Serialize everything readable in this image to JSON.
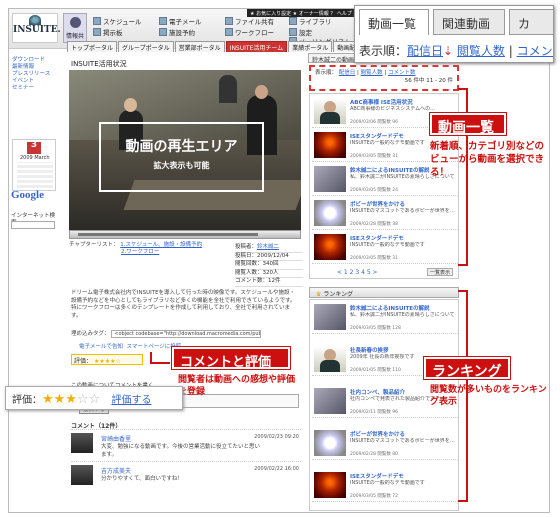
{
  "header": {
    "logo": "INSUITE.",
    "info_button": "情報共有",
    "menu": [
      {
        "label": "スケジュール"
      },
      {
        "label": "電子メール"
      },
      {
        "label": "ファイル共有"
      },
      {
        "label": "ライブラリ"
      },
      {
        "label": "掲示板"
      },
      {
        "label": "施設予約"
      },
      {
        "label": "設定"
      },
      {
        "label": "ワークフロー"
      },
      {
        "label": "メーリングリスト"
      }
    ],
    "topright": "★ お気に入り設定 ★ オーナー情報 ？ ヘルプ ログアウト"
  },
  "nav_tabs": [
    "トップポータル",
    "グループポータル",
    "営業部ポータル",
    "INSUITE活用チーム",
    "業績ポータル",
    "動画配信"
  ],
  "sidebar": {
    "links": [
      "ダウンロード",
      "最新情報",
      "プレスリリース",
      "イベント",
      "セミナー"
    ],
    "calendar_day": "3",
    "calendar_month": "2009 March",
    "search_label": "インターネット検索",
    "google": "Google"
  },
  "video": {
    "page_title": "INSUITE活用状況",
    "play_area_title": "動画の再生エリア",
    "play_area_sub": "拡大表示も可能",
    "chapter_label": "チャプターリスト：",
    "chapter_links": [
      "1.スケジュール、施設・設備予約",
      "2.ワークフロー"
    ],
    "meta": [
      {
        "k": "投稿者：",
        "v": "鈴木誠二"
      },
      {
        "k": "投稿日：",
        "v": "2009/12/04"
      },
      {
        "k": "閲覧回数：",
        "v": "340回"
      },
      {
        "k": "閲覧人数：",
        "v": "320人"
      },
      {
        "k": "コメント数：",
        "v": "12件"
      }
    ],
    "description": "ドリーム電子株式会社内でINSUITEを導入して行った時の映像です。スケジュールや施設・設備予約などを中心としてもライブラリなど多くの機能を全社で利用できているようです。特にワークフローは多くのテンプレートを作成して利用しており、全社で利用されています。",
    "embed_label": "埋め込みタグ：",
    "embed_value": "<object codebase=\"http://download.macromedia.com/pub/shockwave",
    "send_mail": "電子メールで告知",
    "smartphone": "スマートページに投稿",
    "rating_label": "評価：",
    "rating": 4,
    "comment_prompt": "この動画についてコメントを書く",
    "post_button": "投稿する",
    "comments_heading": "コメント（12件）",
    "comments": [
      {
        "name": "宮崎由香里",
        "text": "大変、勉強になる動画です。今後の営業活動に役立てたいと思います。",
        "date": "2009/02/23 09:20"
      },
      {
        "name": "吉方成美夫",
        "text": "分かりやすくて、面白いですね！",
        "date": "2009/02/22 16:00"
      }
    ]
  },
  "list": {
    "header": "鈴木誠二の動画一覧",
    "sort_label": "表示順：",
    "sort_options": [
      "配信日",
      "閲覧人数",
      "コメント数"
    ],
    "page_info": "56 件中 11 - 20 件",
    "items": [
      {
        "title": "ABC商事様 ISE活用状況",
        "desc": "ABC商事様のビジネスシステムへの…",
        "stats": "2009/03/06 閲覧数 96"
      },
      {
        "title": "ISEスタンダードデモ",
        "desc": "INSUITEの一般的なデモ動画です",
        "stats": "2009/03/05 閲覧数 31"
      },
      {
        "title": "鈴木誠二によるINSUITEの解説",
        "desc": "私、鈴木誠二がINSUITEの素晴らしさについて…",
        "stats": "2009/03/05 閲覧数 24"
      },
      {
        "title": "ポビーが世界をかける",
        "desc": "INSUITEのマスコットであるポビーが世界を…",
        "stats": "2009/02/28 閲覧数 38"
      }
    ],
    "pager": "< 1 2 3 4 5 >",
    "all_button": "一覧表示"
  },
  "ranking": {
    "header": "ランキング",
    "items": [
      {
        "title": "鈴木誠二によるINSUITEの解説",
        "desc": "私、鈴木誠二がINSUITEの素晴らしさについて…",
        "stats": "2009/03/05 閲覧数 128"
      },
      {
        "title": "社長新春の挨拶",
        "desc": "2009年 社長の新年挨拶です",
        "stats": "2009/01/05 閲覧数 110"
      },
      {
        "title": "社内コンペ、製品紹介",
        "desc": "社内コンペで発表された製品紹介です",
        "stats": "2009/02/11 閲覧数 96"
      },
      {
        "title": "ポビーが世界をかける",
        "desc": "INSUITEのマスコットであるポビーが世界を…",
        "stats": "2009/02/28 閲覧数 80"
      },
      {
        "title": "ISEスタンダードデモ",
        "desc": "INSUITEの一般的なデモ動画です",
        "stats": "2009/03/05 閲覧数 72"
      }
    ]
  },
  "callouts": {
    "list_title": "動画一覧",
    "list_desc": "新着順、カテゴリ別などのビューから動画を選択できる！",
    "comment_title": "コメントと評価",
    "comment_desc": "閲覧者は動画への感想や評価を登録",
    "ranking_title": "ランキング",
    "ranking_desc": "閲覧数が多いものをランキング表示"
  },
  "zoom_tabs": {
    "tabs": [
      "動画一覧",
      "関連動画",
      "カ"
    ],
    "sort_label": "表示順：",
    "sort_options": [
      "配信日",
      "閲覧人数",
      "コメント数"
    ]
  },
  "zoom_eval": {
    "label": "評価：",
    "rating": 3,
    "link": "評価する"
  },
  "colors": {
    "accent": "#cc1010",
    "link": "#3366cc"
  }
}
